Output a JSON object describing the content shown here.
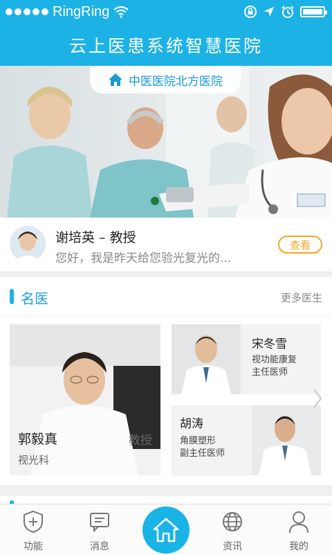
{
  "status_bar": {
    "carrier": "RingRing"
  },
  "app": {
    "title": "云上医患系统智慧医院"
  },
  "banner": {
    "hospital_name": "中医医院北方医院"
  },
  "message": {
    "name": "谢培英 – 教授",
    "preview": "您好，我是昨天给您验光复光的...",
    "button": "查看"
  },
  "famous_doctors": {
    "title": "名医",
    "more": "更多医生",
    "featured": {
      "name": "郭毅真",
      "title": "教授",
      "dept": "视光科"
    },
    "cards": [
      {
        "name": "宋冬雪",
        "line1": "视功能康复",
        "line2": "主任医师"
      },
      {
        "name": "胡涛",
        "line1": "角膜塑形",
        "line2": "副主任医师"
      }
    ]
  },
  "tabs": [
    {
      "label": "功能",
      "icon": "shield-plus-icon"
    },
    {
      "label": "消息",
      "icon": "chat-icon"
    },
    {
      "label": "",
      "icon": "home-icon"
    },
    {
      "label": "资讯",
      "icon": "globe-icon"
    },
    {
      "label": "我的",
      "icon": "user-icon"
    }
  ],
  "colors": {
    "primary": "#1cb2e6",
    "accent": "#f5a623"
  }
}
